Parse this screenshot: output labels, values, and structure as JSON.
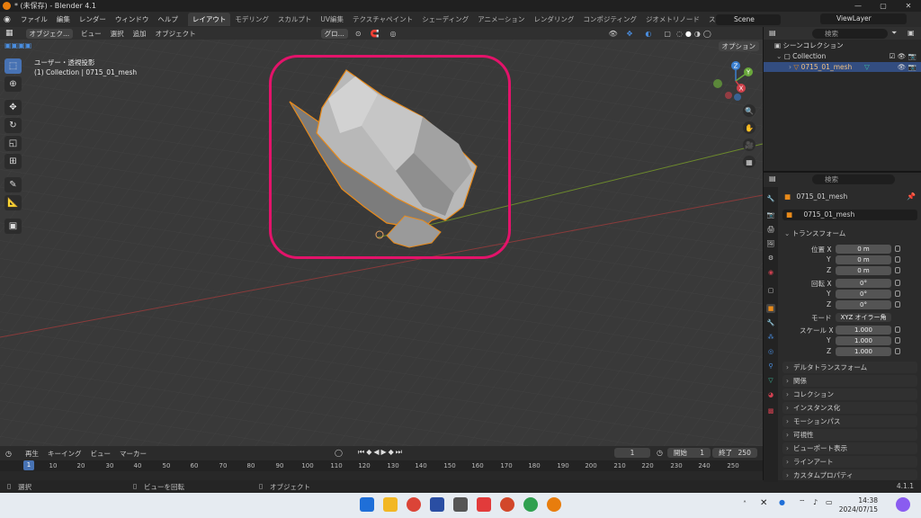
{
  "window": {
    "title": "* (未保存) - Blender 4.1",
    "controls": [
      "—",
      "▢",
      "✕"
    ]
  },
  "topbar": {
    "menus": [
      "ファイル",
      "編集",
      "レンダー",
      "ウィンドウ",
      "ヘルプ"
    ],
    "workspaces": [
      "レイアウト",
      "モデリング",
      "スカルプト",
      "UV編集",
      "テクスチャペイント",
      "シェーディング",
      "アニメーション",
      "レンダリング",
      "コンポジティング",
      "ジオメトリノード",
      "スクリプト作成"
    ],
    "active_workspace": "レイアウト",
    "scene": "Scene",
    "view_layer": "ViewLayer"
  },
  "viewport": {
    "mode": "オブジェク...",
    "menus": [
      "ビュー",
      "選択",
      "追加",
      "オブジェクト"
    ],
    "transform_orientation": "グロ...",
    "options_label": "オプション",
    "view_name": "ユーザー・透視投影",
    "collection_info": "(1) Collection | 0715_01_mesh",
    "gizmo_axes": [
      "Z",
      "Y",
      "X"
    ],
    "object_color": "#e3136a"
  },
  "timeline": {
    "menus": [
      "再生",
      "キーイング",
      "ビュー",
      "マーカー"
    ],
    "current_frame": "1",
    "start_label": "開始",
    "start": "1",
    "end_label": "終了",
    "end": "250",
    "ticks": [
      "1",
      "10",
      "20",
      "30",
      "40",
      "50",
      "60",
      "70",
      "80",
      "90",
      "100",
      "110",
      "120",
      "130",
      "140",
      "150",
      "160",
      "170",
      "180",
      "190",
      "200",
      "210",
      "220",
      "230",
      "240",
      "250"
    ]
  },
  "statusbar": {
    "select": "選択",
    "rotate": "ビューを回転",
    "object": "オブジェクト",
    "version": "4.1.1"
  },
  "outliner": {
    "search_placeholder": "検索",
    "scene_collection": "シーンコレクション",
    "collection": "Collection",
    "mesh": "0715_01_mesh"
  },
  "properties": {
    "search_placeholder": "検索",
    "object_name": "0715_01_mesh",
    "data_name": "0715_01_mesh",
    "transform_title": "トランスフォーム",
    "location_label": "位置 X",
    "rotation_label": "回転 X",
    "mode_label": "モード",
    "mode_value": "XYZ オイラー角",
    "scale_label": "スケール X",
    "axis_y": "Y",
    "axis_z": "Z",
    "location": [
      "0 m",
      "0 m",
      "0 m"
    ],
    "rotation": [
      "0°",
      "0°",
      "0°"
    ],
    "scale": [
      "1.000",
      "1.000",
      "1.000"
    ],
    "panels": [
      "デルタトランスフォーム",
      "関係",
      "コレクション",
      "インスタンス化",
      "モーションパス",
      "可視性",
      "ビューポート表示",
      "ラインアート",
      "カスタムプロパティ"
    ]
  },
  "taskbar": {
    "time": "14:38",
    "date": "2024/07/15"
  }
}
